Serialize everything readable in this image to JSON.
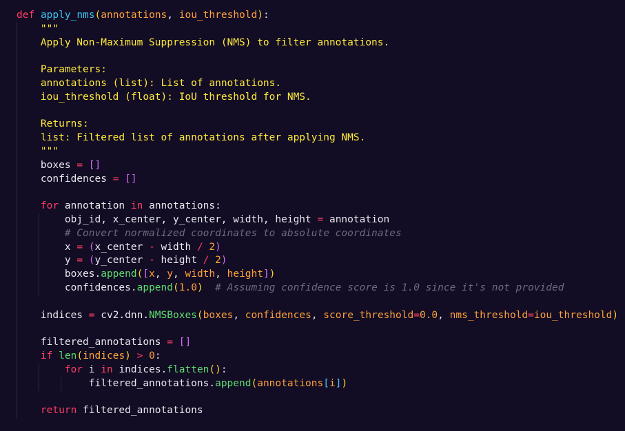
{
  "code_editor": {
    "language": "python",
    "theme": {
      "background": "#120c24",
      "keyword": "#ff3f63",
      "function_name": "#3cc8f0",
      "parameter": "#ffa23a",
      "docstring": "#ffea3b",
      "comment": "#6c6c7e",
      "default_text": "#e8e8ee"
    },
    "lines": [
      [
        {
          "t": "def",
          "c": "kw"
        },
        {
          "t": " "
        },
        {
          "t": "apply_nms",
          "c": "fn"
        },
        {
          "t": "(",
          "c": "br-y"
        },
        {
          "t": "annotations",
          "c": "param"
        },
        {
          "t": ", "
        },
        {
          "t": "iou_threshold",
          "c": "param"
        },
        {
          "t": ")",
          "c": "br-y"
        },
        {
          "t": ":"
        }
      ],
      [
        {
          "t": "    "
        },
        {
          "t": "\"\"\"",
          "c": "doc"
        }
      ],
      [
        {
          "t": "    "
        },
        {
          "t": "Apply Non-Maximum Suppression (NMS) to filter annotations.",
          "c": "doc"
        }
      ],
      [],
      [
        {
          "t": "    "
        },
        {
          "t": "Parameters:",
          "c": "doc"
        }
      ],
      [
        {
          "t": "    "
        },
        {
          "t": "annotations (list): List of annotations.",
          "c": "doc"
        }
      ],
      [
        {
          "t": "    "
        },
        {
          "t": "iou_threshold (float): IoU threshold for NMS.",
          "c": "doc"
        }
      ],
      [],
      [
        {
          "t": "    "
        },
        {
          "t": "Returns:",
          "c": "doc"
        }
      ],
      [
        {
          "t": "    "
        },
        {
          "t": "list: Filtered list of annotations after applying NMS.",
          "c": "doc"
        }
      ],
      [
        {
          "t": "    "
        },
        {
          "t": "\"\"\"",
          "c": "doc"
        }
      ],
      [
        {
          "t": "    boxes "
        },
        {
          "t": "=",
          "c": "op"
        },
        {
          "t": " "
        },
        {
          "t": "[]",
          "c": "br-p"
        }
      ],
      [
        {
          "t": "    confidences "
        },
        {
          "t": "=",
          "c": "op"
        },
        {
          "t": " "
        },
        {
          "t": "[]",
          "c": "br-p"
        }
      ],
      [],
      [
        {
          "t": "    "
        },
        {
          "t": "for",
          "c": "kw"
        },
        {
          "t": " annotation "
        },
        {
          "t": "in",
          "c": "kw"
        },
        {
          "t": " annotations:"
        }
      ],
      [
        {
          "t": "        obj_id, x_center, y_center, width, height "
        },
        {
          "t": "=",
          "c": "op"
        },
        {
          "t": " annotation"
        }
      ],
      [
        {
          "t": "        "
        },
        {
          "t": "# Convert normalized coordinates to absolute coordinates",
          "c": "cm"
        }
      ],
      [
        {
          "t": "        x "
        },
        {
          "t": "=",
          "c": "op"
        },
        {
          "t": " "
        },
        {
          "t": "(",
          "c": "br-p"
        },
        {
          "t": "x_center "
        },
        {
          "t": "-",
          "c": "op"
        },
        {
          "t": " width "
        },
        {
          "t": "/",
          "c": "op"
        },
        {
          "t": " "
        },
        {
          "t": "2",
          "c": "num"
        },
        {
          "t": ")",
          "c": "br-p"
        }
      ],
      [
        {
          "t": "        y "
        },
        {
          "t": "=",
          "c": "op"
        },
        {
          "t": " "
        },
        {
          "t": "(",
          "c": "br-p"
        },
        {
          "t": "y_center "
        },
        {
          "t": "-",
          "c": "op"
        },
        {
          "t": " height "
        },
        {
          "t": "/",
          "c": "op"
        },
        {
          "t": " "
        },
        {
          "t": "2",
          "c": "num"
        },
        {
          "t": ")",
          "c": "br-p"
        }
      ],
      [
        {
          "t": "        boxes."
        },
        {
          "t": "append",
          "c": "method"
        },
        {
          "t": "(",
          "c": "br-y"
        },
        {
          "t": "[",
          "c": "br-p"
        },
        {
          "t": "x",
          "c": "arg"
        },
        {
          "t": ", "
        },
        {
          "t": "y",
          "c": "arg"
        },
        {
          "t": ", "
        },
        {
          "t": "width",
          "c": "arg"
        },
        {
          "t": ", "
        },
        {
          "t": "height",
          "c": "arg"
        },
        {
          "t": "]",
          "c": "br-p"
        },
        {
          "t": ")",
          "c": "br-y"
        }
      ],
      [
        {
          "t": "        confidences."
        },
        {
          "t": "append",
          "c": "method"
        },
        {
          "t": "(",
          "c": "br-y"
        },
        {
          "t": "1.0",
          "c": "num"
        },
        {
          "t": ")",
          "c": "br-y"
        },
        {
          "t": "  "
        },
        {
          "t": "# Assuming confidence score is 1.0 since it's not provided",
          "c": "cm"
        }
      ],
      [],
      [
        {
          "t": "    indices "
        },
        {
          "t": "=",
          "c": "op"
        },
        {
          "t": " cv2.dnn."
        },
        {
          "t": "NMSBoxes",
          "c": "method"
        },
        {
          "t": "(",
          "c": "br-y"
        },
        {
          "t": "boxes",
          "c": "arg"
        },
        {
          "t": ", "
        },
        {
          "t": "confidences",
          "c": "arg"
        },
        {
          "t": ", "
        },
        {
          "t": "score_threshold",
          "c": "arg"
        },
        {
          "t": "=",
          "c": "op"
        },
        {
          "t": "0.0",
          "c": "num"
        },
        {
          "t": ", "
        },
        {
          "t": "nms_threshold",
          "c": "arg"
        },
        {
          "t": "=",
          "c": "op"
        },
        {
          "t": "iou_threshold",
          "c": "arg"
        },
        {
          "t": ")",
          "c": "br-y"
        }
      ],
      [],
      [
        {
          "t": "    filtered_annotations "
        },
        {
          "t": "=",
          "c": "op"
        },
        {
          "t": " "
        },
        {
          "t": "[]",
          "c": "br-p"
        }
      ],
      [
        {
          "t": "    "
        },
        {
          "t": "if",
          "c": "kw"
        },
        {
          "t": " "
        },
        {
          "t": "len",
          "c": "builtin"
        },
        {
          "t": "(",
          "c": "br-y"
        },
        {
          "t": "indices",
          "c": "arg"
        },
        {
          "t": ")",
          "c": "br-y"
        },
        {
          "t": " "
        },
        {
          "t": ">",
          "c": "op"
        },
        {
          "t": " "
        },
        {
          "t": "0",
          "c": "num"
        },
        {
          "t": ":"
        }
      ],
      [
        {
          "t": "        "
        },
        {
          "t": "for",
          "c": "kw"
        },
        {
          "t": " i "
        },
        {
          "t": "in",
          "c": "kw"
        },
        {
          "t": " indices."
        },
        {
          "t": "flatten",
          "c": "method"
        },
        {
          "t": "(",
          "c": "br-y"
        },
        {
          "t": ")",
          "c": "br-y"
        },
        {
          "t": ":"
        }
      ],
      [
        {
          "t": "            filtered_annotations."
        },
        {
          "t": "append",
          "c": "method"
        },
        {
          "t": "(",
          "c": "br-y"
        },
        {
          "t": "annotations",
          "c": "arg"
        },
        {
          "t": "[",
          "c": "br-c"
        },
        {
          "t": "i",
          "c": "arg"
        },
        {
          "t": "]",
          "c": "br-c"
        },
        {
          "t": ")",
          "c": "br-y"
        }
      ],
      [],
      [
        {
          "t": "    "
        },
        {
          "t": "return",
          "c": "kw"
        },
        {
          "t": " filtered_annotations"
        }
      ]
    ]
  }
}
